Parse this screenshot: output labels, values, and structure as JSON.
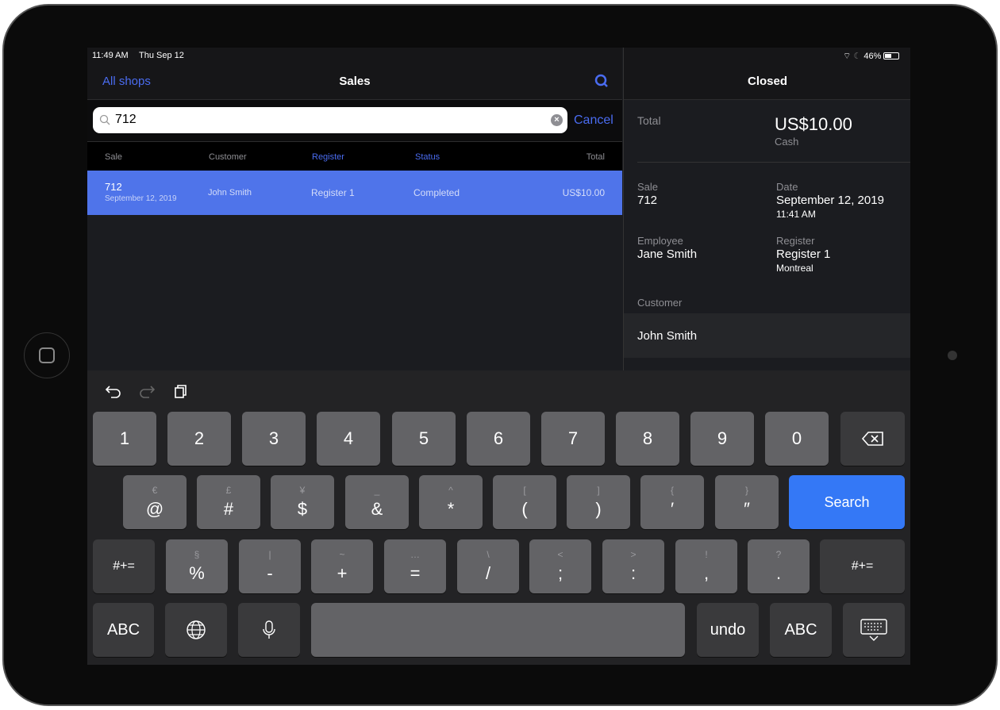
{
  "status": {
    "time": "11:49 AM",
    "date": "Thu Sep 12",
    "battery": "46%"
  },
  "left": {
    "back": "All shops",
    "title": "Sales",
    "search_value": "712",
    "cancel": "Cancel",
    "columns": [
      "Sale",
      "Customer",
      "Register",
      "Status",
      "Total"
    ],
    "rows": [
      {
        "sale": "712",
        "date": "September 12, 2019",
        "customer": "John Smith",
        "register": "Register 1",
        "status": "Completed",
        "total": "US$10.00"
      }
    ]
  },
  "right": {
    "title": "Closed",
    "total_label": "Total",
    "total": "US$10.00",
    "payment": "Cash",
    "sale_label": "Sale",
    "sale": "712",
    "date_label": "Date",
    "date": "September 12, 2019",
    "time": "11:41 AM",
    "employee_label": "Employee",
    "employee": "Jane Smith",
    "register_label": "Register",
    "register": "Register 1",
    "location": "Montreal",
    "customer_label": "Customer",
    "customer": "John Smith"
  },
  "colors": {
    "accent": "#4a6cf0",
    "selected_row": "#4f74ea",
    "search_key": "#3478f6"
  },
  "keyboard": {
    "row1": [
      "1",
      "2",
      "3",
      "4",
      "5",
      "6",
      "7",
      "8",
      "9",
      "0"
    ],
    "row2": [
      [
        "€",
        "@"
      ],
      [
        "£",
        "#"
      ],
      [
        "¥",
        "$"
      ],
      [
        "_",
        "&"
      ],
      [
        "^",
        "*"
      ],
      [
        "[",
        "("
      ],
      [
        "]",
        ")"
      ],
      [
        "{",
        "′"
      ],
      [
        "}",
        "″"
      ]
    ],
    "search": "Search",
    "row3": [
      [
        "§",
        "%"
      ],
      [
        "|",
        "-"
      ],
      [
        "~",
        "+"
      ],
      [
        "…",
        "="
      ],
      [
        "\\",
        "/"
      ],
      [
        "<",
        ";"
      ],
      [
        ">",
        ":"
      ],
      [
        "!",
        ","
      ],
      [
        "?",
        "."
      ]
    ],
    "shift": "#+=",
    "abc": "ABC",
    "undo": "undo"
  }
}
